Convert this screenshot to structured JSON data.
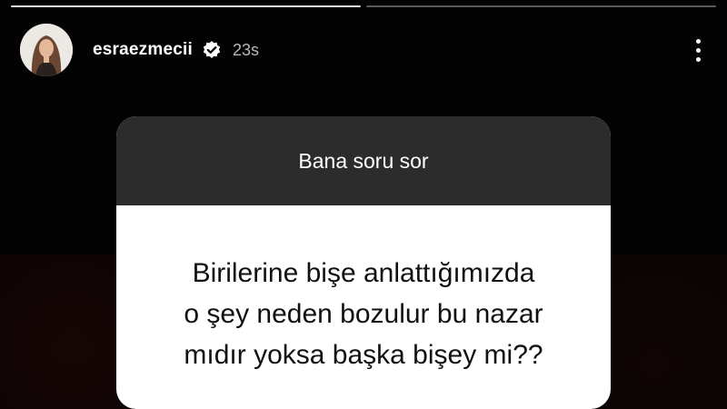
{
  "story": {
    "progress_segments": 2,
    "progress_current": 1
  },
  "header": {
    "username": "esraezmecii",
    "verified": true,
    "verified_icon": "verified-badge-icon",
    "time": "23s",
    "more_icon": "more-vertical-icon"
  },
  "question_sticker": {
    "prompt": "Bana soru sor",
    "question_lines": [
      "Birilerine bişe anlattığımızda",
      "o şey neden bozulur bu nazar",
      "mıdır yoksa başka bişey mi??"
    ]
  },
  "colors": {
    "background": "#030303",
    "sticker_header": "#2c2c2c",
    "sticker_body": "#ffffff"
  }
}
